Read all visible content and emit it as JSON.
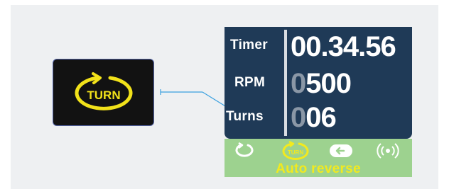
{
  "callout": {
    "icon": "turn-icon",
    "icon_text": "TURN"
  },
  "display": {
    "rows": [
      {
        "label": "Timer",
        "value": "00.34.56",
        "leading": ""
      },
      {
        "label": "RPM",
        "value": "500",
        "leading": "0"
      },
      {
        "label": "Turns",
        "value": "06",
        "leading": "0"
      }
    ]
  },
  "status_bar": {
    "icons": [
      "rotate-icon",
      "turn-icon",
      "arrow-left-icon",
      "signal-icon"
    ],
    "active_icon": "turn-icon",
    "caption": "Auto reverse"
  },
  "colors": {
    "display_bg": "#1f3a57",
    "status_bg": "#9dd28f",
    "accent_yellow": "#f2ea1e",
    "callout_bg": "#121212",
    "leader_line": "#3aa0e0"
  }
}
